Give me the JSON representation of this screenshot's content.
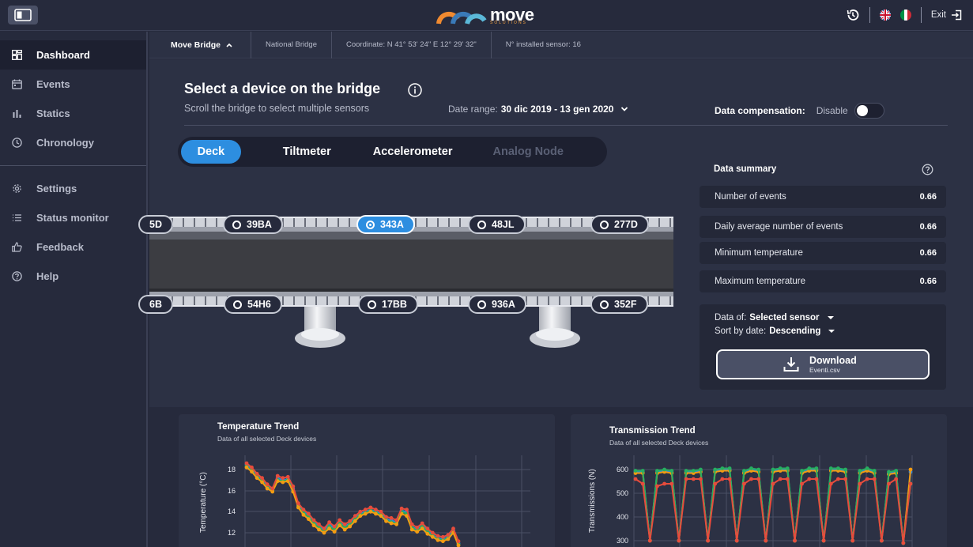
{
  "header": {
    "logo_text": "move",
    "logo_sub": "SOLUTIONS",
    "exit_label": "Exit",
    "colors": {
      "background": "#262a3c",
      "accent": "#2d8ee0",
      "logo_orange": "#f0a040"
    }
  },
  "sidebar": {
    "items": [
      {
        "label": "Dashboard",
        "icon": "dashboard-icon",
        "active": true
      },
      {
        "label": "Events",
        "icon": "calendar-icon"
      },
      {
        "label": "Statics",
        "icon": "bar-chart-icon"
      },
      {
        "label": "Chronology",
        "icon": "clock-icon"
      }
    ],
    "items2": [
      {
        "label": "Settings",
        "icon": "gear-icon"
      },
      {
        "label": "Status monitor",
        "icon": "list-icon"
      },
      {
        "label": "Feedback",
        "icon": "thumbs-up-icon"
      },
      {
        "label": "Help",
        "icon": "help-icon"
      }
    ]
  },
  "infobar": {
    "bridge_name": "Move Bridge",
    "bridge_type": "National Bridge",
    "coordinate": "Coordinate: N 41° 53' 24\" E 12° 29' 32\"",
    "sensors": "N° installed sensor: 16"
  },
  "main": {
    "title": "Select a device on the bridge",
    "subtitle": "Scroll the bridge to select multiple sensors",
    "date_label": "Date range:",
    "date_value": "30 dic 2019 - 13 gen 2020",
    "comp_label": "Data compensation:",
    "comp_value": "Disable",
    "tabs": [
      "Deck",
      "Tiltmeter",
      "Accelerometer",
      "Analog Node"
    ]
  },
  "bridge": {
    "top_sensors": [
      "39BA",
      "343A",
      "48JL",
      "277D"
    ],
    "bottom_sensors": [
      "54H6",
      "17BB",
      "936A",
      "352F"
    ],
    "edge_top": "5D",
    "edge_bottom": "6B",
    "selected_sensor": "343A"
  },
  "summary": {
    "title": "Data summary",
    "rows": [
      {
        "label": "Number of events",
        "value": "0.66"
      },
      {
        "label": "Daily average number of events",
        "value": "0.66"
      },
      {
        "label": "Minimum temperature",
        "value": "0.66"
      },
      {
        "label": "Maximum temperature",
        "value": "0.66"
      }
    ],
    "data_of_label": "Data of:",
    "data_of_value": "Selected sensor",
    "sort_label": "Sort by date:",
    "sort_value": "Descending",
    "download_label": "Download",
    "download_file": "Eventi.csv"
  },
  "chart_data": [
    {
      "type": "line",
      "title": "Temperature Trend",
      "subtitle": "Data of all selected Deck devices",
      "ylabel": "Temperature (°C)",
      "yticks": [
        "18",
        "16",
        "14",
        "12"
      ],
      "ylim": [
        10,
        19
      ],
      "series": [
        {
          "color": "#2e86de",
          "values": [
            18.5,
            18.0,
            17.4,
            17.0,
            16.4,
            16.0,
            17.2,
            17.0,
            17.1,
            16.2,
            14.6,
            14.0,
            13.6,
            13.0,
            12.6,
            12.2,
            12.8,
            12.4,
            13.0,
            12.6,
            12.9,
            13.4,
            13.8,
            14.0,
            14.2,
            14.0,
            13.8,
            13.3,
            13.2,
            13.0,
            14.1,
            14.0,
            12.6,
            12.3,
            12.7,
            12.2,
            11.8,
            11.5,
            11.4,
            11.6,
            12.2,
            11.0
          ]
        },
        {
          "color": "#27ae60",
          "values": [
            18.3,
            17.9,
            17.3,
            16.9,
            16.3,
            16.0,
            17.0,
            16.9,
            17.0,
            16.0,
            14.5,
            13.9,
            13.5,
            12.9,
            12.5,
            12.1,
            12.6,
            12.3,
            12.9,
            12.5,
            12.8,
            13.3,
            13.7,
            13.9,
            14.1,
            13.9,
            13.7,
            13.2,
            13.0,
            12.9,
            14.0,
            13.8,
            12.5,
            12.2,
            12.6,
            12.1,
            11.7,
            11.4,
            11.3,
            11.5,
            12.1,
            10.9
          ]
        },
        {
          "color": "#f39c12",
          "values": [
            18.2,
            17.8,
            17.2,
            16.8,
            16.2,
            15.9,
            16.9,
            16.8,
            16.9,
            15.9,
            14.4,
            13.7,
            13.3,
            12.7,
            12.3,
            12.0,
            12.4,
            12.1,
            12.7,
            12.3,
            12.6,
            13.1,
            13.6,
            13.8,
            14.0,
            13.8,
            13.6,
            13.1,
            12.9,
            12.8,
            13.8,
            13.6,
            12.3,
            12.1,
            12.4,
            11.9,
            11.6,
            11.3,
            11.2,
            11.4,
            12.0,
            10.8
          ]
        },
        {
          "color": "#e74c3c",
          "values": [
            18.6,
            18.2,
            17.6,
            17.2,
            16.6,
            16.2,
            17.4,
            17.2,
            17.3,
            16.4,
            14.8,
            14.2,
            13.8,
            13.2,
            12.8,
            12.4,
            13.0,
            12.6,
            13.2,
            12.8,
            13.1,
            13.6,
            14.0,
            14.2,
            14.4,
            14.2,
            14.0,
            13.5,
            13.4,
            13.2,
            14.3,
            14.2,
            12.8,
            12.5,
            12.9,
            12.4,
            12.0,
            11.7,
            11.6,
            11.8,
            12.4,
            11.2
          ]
        }
      ]
    },
    {
      "type": "line",
      "title": "Transmission Trend",
      "subtitle": "Data of all selected Deck devices",
      "ylabel": "Transmissions (N)",
      "yticks": [
        "600",
        "500",
        "400",
        "300"
      ],
      "ylim": [
        280,
        640
      ],
      "series": [
        {
          "color": "#2e86de",
          "values": [
            590,
            590,
            300,
            590,
            595,
            590,
            300,
            590,
            590,
            595,
            300,
            595,
            600,
            600,
            300,
            590,
            600,
            595,
            300,
            595,
            600,
            600,
            300,
            590,
            600,
            600,
            300,
            600,
            600,
            595,
            300,
            590,
            600,
            590,
            300,
            585,
            590,
            290,
            590
          ]
        },
        {
          "color": "#f39c12",
          "values": [
            585,
            585,
            300,
            585,
            590,
            585,
            300,
            585,
            585,
            590,
            300,
            590,
            595,
            595,
            300,
            585,
            595,
            590,
            300,
            590,
            595,
            595,
            300,
            585,
            595,
            595,
            300,
            595,
            595,
            590,
            300,
            585,
            595,
            585,
            300,
            580,
            585,
            290,
            600
          ]
        },
        {
          "color": "#27ae60",
          "values": [
            595,
            595,
            300,
            595,
            600,
            595,
            300,
            595,
            595,
            600,
            300,
            600,
            605,
            605,
            300,
            595,
            605,
            600,
            300,
            600,
            605,
            605,
            300,
            595,
            605,
            605,
            300,
            605,
            605,
            600,
            300,
            595,
            605,
            595,
            300,
            590,
            595,
            290,
            540
          ]
        },
        {
          "color": "#e74c3c",
          "values": [
            560,
            540,
            300,
            530,
            540,
            540,
            300,
            560,
            560,
            560,
            300,
            540,
            560,
            560,
            300,
            540,
            560,
            560,
            300,
            540,
            560,
            560,
            300,
            540,
            560,
            560,
            300,
            540,
            560,
            560,
            300,
            540,
            560,
            560,
            300,
            540,
            560,
            290,
            540
          ]
        }
      ]
    }
  ]
}
